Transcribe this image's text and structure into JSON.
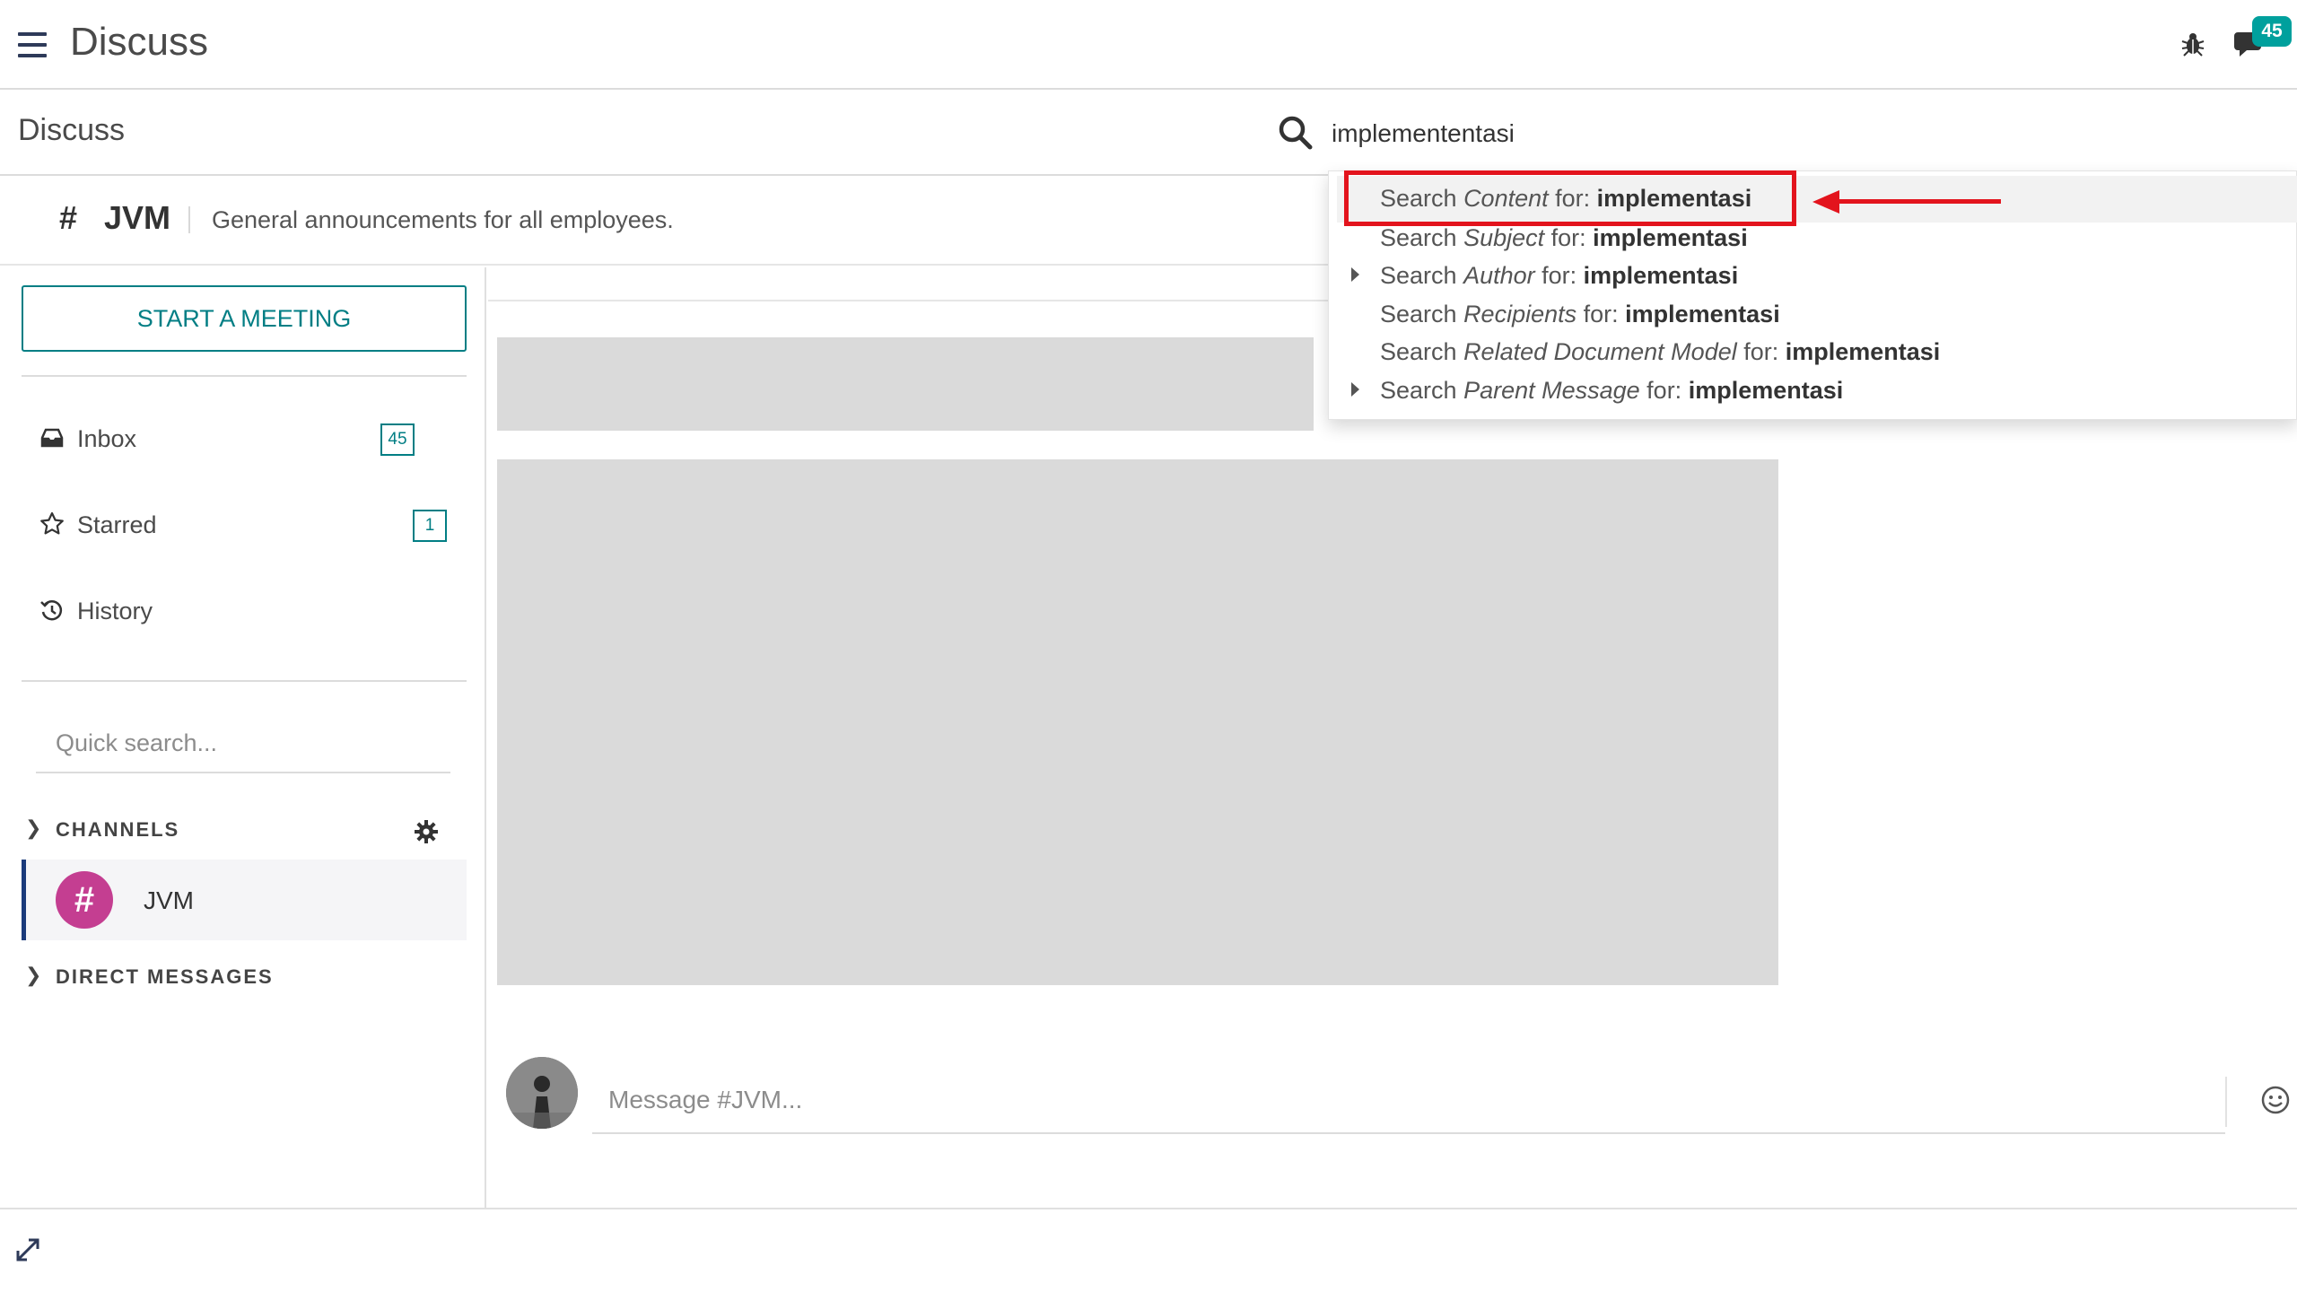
{
  "topbar": {
    "app_title": "Discuss",
    "notification_count": "45",
    "icons": [
      "hamburger-menu-icon",
      "bug-icon",
      "chat-icon"
    ]
  },
  "control_panel": {
    "breadcrumb": "Discuss",
    "search": {
      "value": "implemententasi",
      "icon": "search-icon"
    },
    "autocomplete": [
      {
        "prefix": "Search ",
        "field": "Content",
        "middle": " for: ",
        "term": "implementasi",
        "expandable": false,
        "highlighted": true
      },
      {
        "prefix": "Search ",
        "field": "Subject",
        "middle": " for: ",
        "term": "implementasi",
        "expandable": false,
        "highlighted": false
      },
      {
        "prefix": "Search ",
        "field": "Author",
        "middle": " for: ",
        "term": "implementasi",
        "expandable": true,
        "highlighted": false
      },
      {
        "prefix": "Search ",
        "field": "Recipients",
        "middle": " for: ",
        "term": "implementasi",
        "expandable": false,
        "highlighted": false
      },
      {
        "prefix": "Search ",
        "field": "Related Document Model",
        "middle": " for: ",
        "term": "implementasi",
        "expandable": false,
        "highlighted": false
      },
      {
        "prefix": "Search ",
        "field": "Parent Message",
        "middle": " for: ",
        "term": "implementasi",
        "expandable": true,
        "highlighted": false
      }
    ]
  },
  "thread_header": {
    "hash": "#",
    "name": "JVM",
    "description": "General announcements for all employees."
  },
  "sidebar": {
    "start_meeting": "START A MEETING",
    "items": [
      {
        "label": "Inbox",
        "icon": "inbox-icon",
        "counter": "45"
      },
      {
        "label": "Starred",
        "icon": "star-icon",
        "counter": "1"
      },
      {
        "label": "History",
        "icon": "history-icon",
        "counter": ""
      }
    ],
    "quick_search_placeholder": "Quick search...",
    "channels_label": "CHANNELS",
    "channels": [
      {
        "name": "JVM",
        "avatar": "#"
      }
    ],
    "direct_messages_label": "DIRECT MESSAGES"
  },
  "composer": {
    "placeholder": "Message #JVM..."
  },
  "colors": {
    "accent": "#017e84",
    "badge": "#00a09d",
    "channel_avatar": "#c43e91",
    "annotation_red": "#e3141d"
  }
}
